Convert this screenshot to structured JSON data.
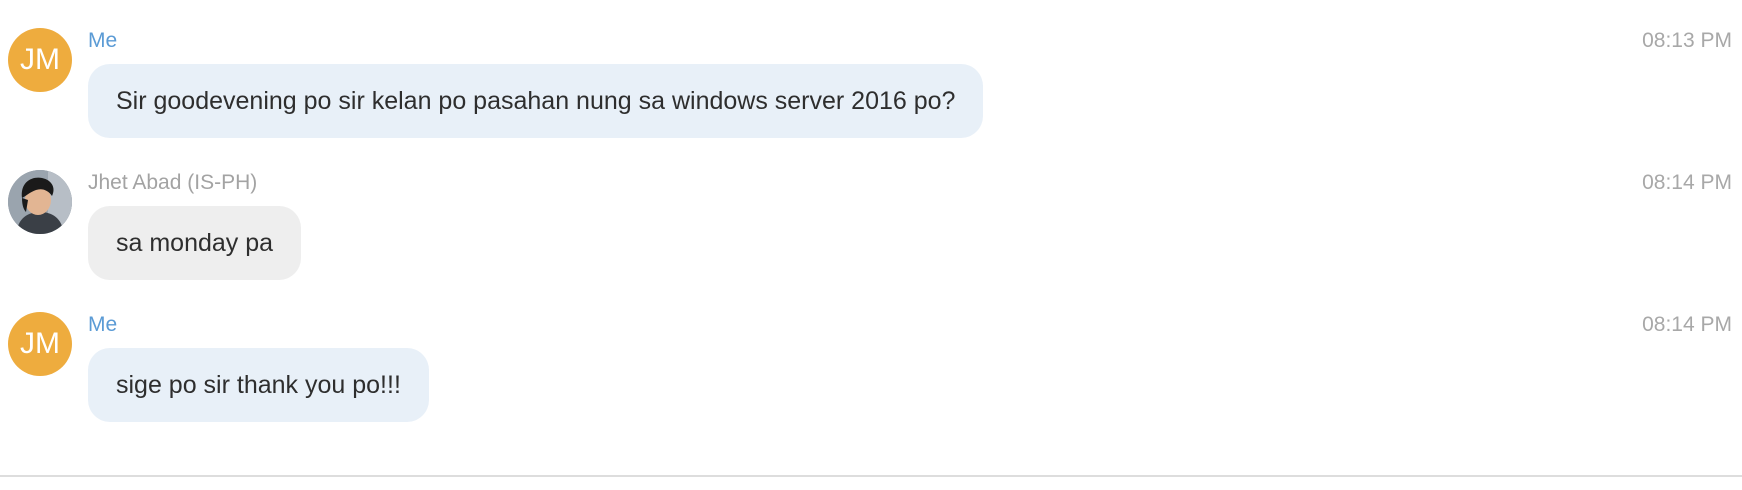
{
  "messages": [
    {
      "avatar_initials": "JM",
      "sender": "Me",
      "time": "08:13 PM",
      "text": "Sir goodevening po sir kelan po pasahan nung sa windows server 2016 po?"
    },
    {
      "avatar_initials": "",
      "sender": "Jhet Abad (IS-PH)",
      "time": "08:14 PM",
      "text": "sa monday pa"
    },
    {
      "avatar_initials": "JM",
      "sender": "Me",
      "time": "08:14 PM",
      "text": "sige po sir thank you po!!!"
    }
  ],
  "colors": {
    "avatar_bg": "#eeac3e",
    "my_name": "#5b9bd5",
    "other_name": "#a3a3a3",
    "my_bubble": "#e8f0f8",
    "their_bubble": "#eeeeee"
  }
}
